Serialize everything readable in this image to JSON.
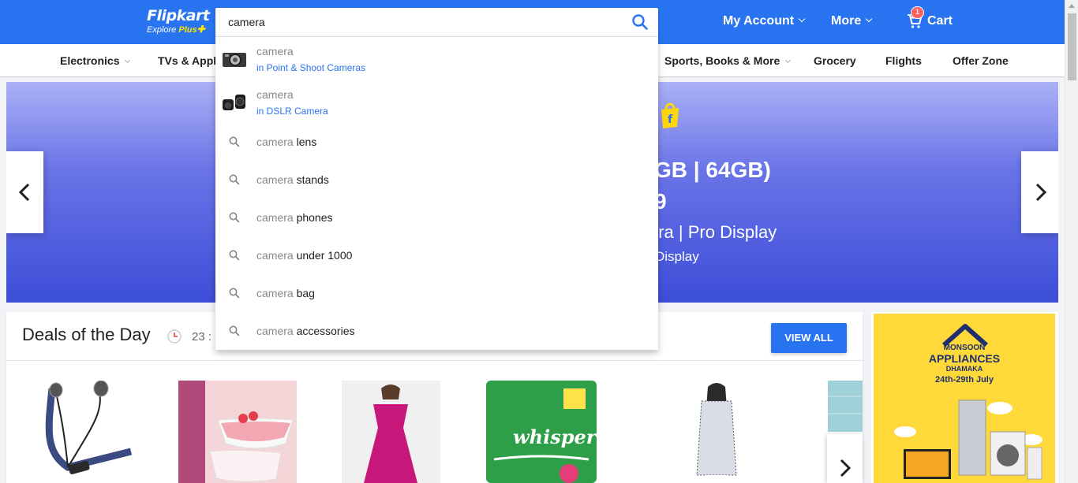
{
  "header": {
    "logo": "Flipkart",
    "logo_sub_explore": "Explore",
    "logo_sub_plus": "Plus",
    "search_value": "camera",
    "my_account": "My Account",
    "more": "More",
    "cart": "Cart",
    "cart_count": "1",
    "brand_color": "#2874f0"
  },
  "nav": {
    "items": [
      "Electronics",
      "TVs & Appli",
      "Sports, Books & More",
      "Grocery",
      "Flights",
      "Offer Zone"
    ]
  },
  "banner": {
    "line1": "GB | 64GB)",
    "line2": "9",
    "line3": "era | Pro Display",
    "line4": "Display"
  },
  "deals": {
    "title": "Deals of the Day",
    "timer": "23 :",
    "view_all": "VIEW ALL"
  },
  "side_ad": {
    "line1": "MONSOON",
    "line2": "APPLIANCES",
    "line3": "DHAMAKA",
    "dates": "24th-29th July"
  },
  "product_labels": {
    "whisper": "whisper"
  },
  "suggestions": {
    "products": [
      {
        "term": "camera",
        "category": "in Point & Shoot Cameras"
      },
      {
        "term": "camera",
        "category": "in DSLR Camera"
      }
    ],
    "queries": [
      {
        "prefix": "camera",
        "suffix": "lens"
      },
      {
        "prefix": "camera",
        "suffix": "stands"
      },
      {
        "prefix": "camera",
        "suffix": "phones"
      },
      {
        "prefix": "camera",
        "suffix": "under 1000"
      },
      {
        "prefix": "camera",
        "suffix": "bag"
      },
      {
        "prefix": "camera",
        "suffix": "accessories"
      }
    ]
  }
}
